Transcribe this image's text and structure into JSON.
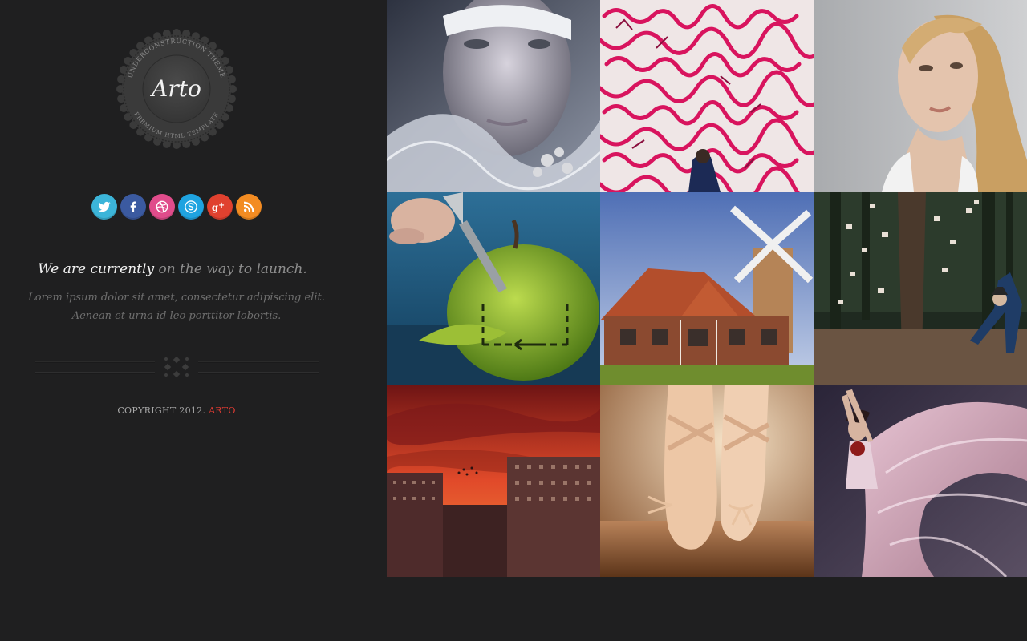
{
  "brand": {
    "name": "Arto",
    "ring_top": "UNDERCONSTRUCTION THEME",
    "ring_bottom": "PREMIUM HTML TEMPLATE"
  },
  "social": [
    {
      "name": "twitter",
      "color": "#3cb5d9",
      "icon": "twitter-icon"
    },
    {
      "name": "facebook",
      "color": "#3b5aa0",
      "icon": "facebook-icon"
    },
    {
      "name": "dribbble",
      "color": "#e04c8b",
      "icon": "dribbble-icon"
    },
    {
      "name": "skype",
      "color": "#1fa3e0",
      "icon": "skype-icon"
    },
    {
      "name": "google-plus",
      "color": "#e0412f",
      "icon": "google-plus-icon"
    },
    {
      "name": "rss",
      "color": "#f38c22",
      "icon": "rss-icon"
    }
  ],
  "tagline": {
    "strong": "We are currently",
    "rest": "on the way to launch."
  },
  "lorem": {
    "line1": "Lorem ipsum dolor sit amet, consectetur adipiscing elit.",
    "line2": "Aenean et urna id leo porttitor lobortis."
  },
  "footer": {
    "copyright": "COPYRIGHT 2012.",
    "brand": "ARTO"
  },
  "gallery": [
    {
      "subject": "frosted-face-portrait"
    },
    {
      "subject": "pink-graffiti-wall"
    },
    {
      "subject": "blonde-woman-portrait"
    },
    {
      "subject": "green-apple-scalpel"
    },
    {
      "subject": "windmill-house"
    },
    {
      "subject": "forest-cards-dancer"
    },
    {
      "subject": "red-sky-city"
    },
    {
      "subject": "ballet-pointe-shoes"
    },
    {
      "subject": "dancer-flowing-dress"
    }
  ],
  "colors": {
    "background": "#1f1f20",
    "accent": "#e23c33"
  }
}
